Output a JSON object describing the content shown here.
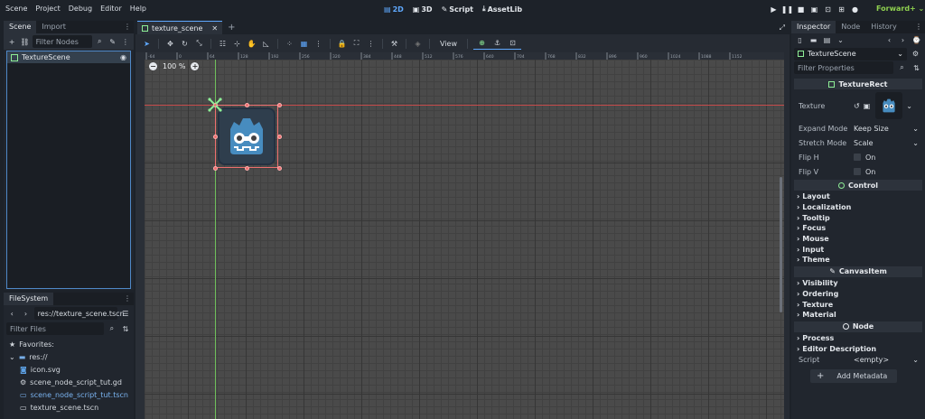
{
  "menu": [
    "Scene",
    "Project",
    "Debug",
    "Editor",
    "Help"
  ],
  "workspaces": [
    {
      "label": "2D",
      "icon": "2d-icon",
      "active": true
    },
    {
      "label": "3D",
      "icon": "3d-icon",
      "active": false
    },
    {
      "label": "Script",
      "icon": "script-icon",
      "active": false
    },
    {
      "label": "AssetLib",
      "icon": "assetlib-icon",
      "active": false
    }
  ],
  "renderer": "Forward+",
  "colors": {
    "accent": "#5fa9ff",
    "renderer": "#8fd14f",
    "selection": "#ee6f6f",
    "node_green": "#8eef97"
  },
  "left_dock": {
    "tabs": [
      "Scene",
      "Import"
    ],
    "filter_placeholder": "Filter Nodes",
    "tree": [
      {
        "label": "TextureScene",
        "icon": "texturerect-icon"
      }
    ]
  },
  "filesystem": {
    "tab": "FileSystem",
    "path": "res://texture_scene.tscn",
    "filter_placeholder": "Filter Files",
    "favorites": "Favorites:",
    "root": "res://",
    "files": [
      {
        "label": "icon.svg",
        "icon": "image-icon",
        "highlight": false
      },
      {
        "label": "scene_node_script_tut.gd",
        "icon": "gear-icon",
        "highlight": false
      },
      {
        "label": "scene_node_script_tut.tscn",
        "icon": "scene-icon",
        "highlight": true
      },
      {
        "label": "texture_scene.tscn",
        "icon": "scene-icon",
        "highlight": false
      }
    ]
  },
  "editor_tab": "texture_scene",
  "toolbar": {
    "view_label": "View"
  },
  "zoom": "100 %",
  "inspector": {
    "tabs": [
      "Inspector",
      "Node",
      "History"
    ],
    "object": "TextureScene",
    "filter_placeholder": "Filter Properties",
    "class_header": "TextureRect",
    "texture_label": "Texture",
    "props": [
      {
        "name": "Expand Mode",
        "value": "Keep Size",
        "type": "dropdown"
      },
      {
        "name": "Stretch Mode",
        "value": "Scale",
        "type": "dropdown"
      },
      {
        "name": "Flip H",
        "value": "On",
        "type": "check"
      },
      {
        "name": "Flip V",
        "value": "On",
        "type": "check"
      }
    ],
    "control_header": "Control",
    "control_sections": [
      "Layout",
      "Localization",
      "Tooltip",
      "Focus",
      "Mouse",
      "Input",
      "Theme"
    ],
    "canvasitem_header": "CanvasItem",
    "canvasitem_sections": [
      "Visibility",
      "Ordering",
      "Texture",
      "Material"
    ],
    "node_header": "Node",
    "node_sections": [
      "Process",
      "Editor Description"
    ],
    "script_label": "Script",
    "script_value": "<empty>",
    "add_metadata": "Add Metadata"
  },
  "ruler_h": [
    "-64",
    "0",
    "64",
    "128",
    "192",
    "256",
    "320",
    "384",
    "448",
    "512",
    "576",
    "640",
    "704",
    "768",
    "832",
    "896",
    "960",
    "1024",
    "1088",
    "1152"
  ]
}
